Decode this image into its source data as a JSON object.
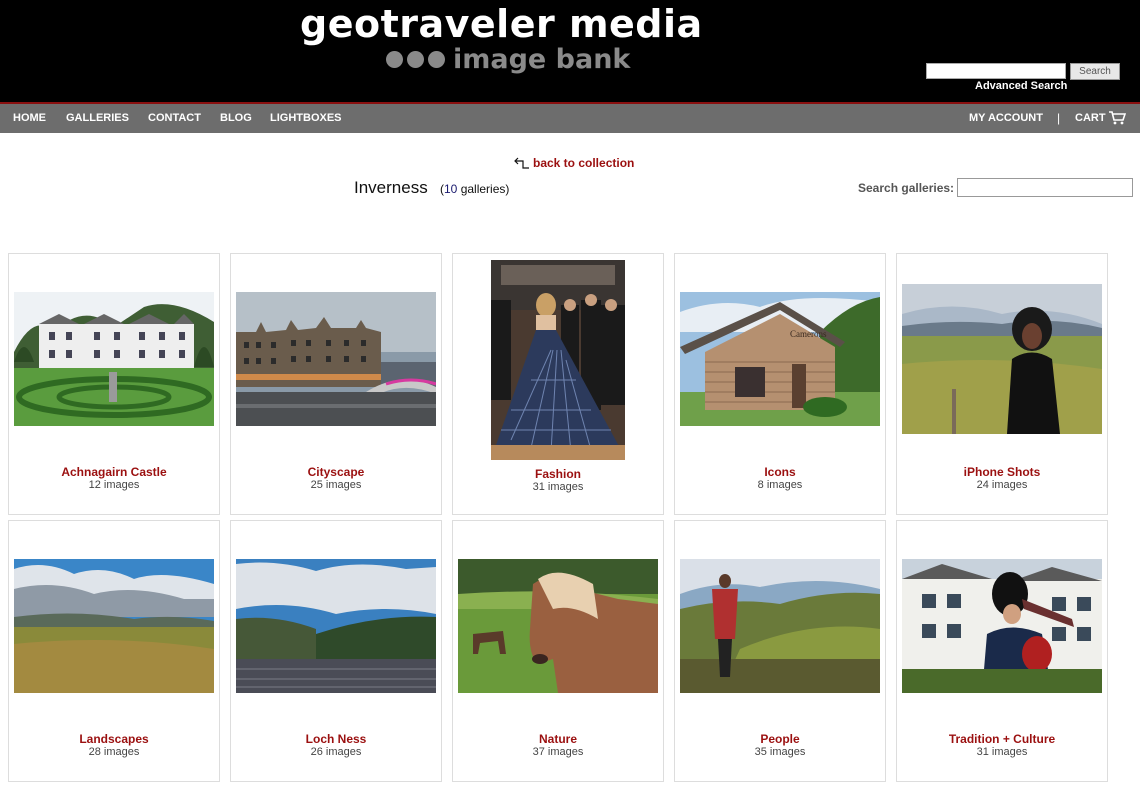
{
  "brand": {
    "title": "geotraveler media",
    "subtitle": "image bank"
  },
  "header_search": {
    "button_label": "Search",
    "advanced_label": "Advanced Search"
  },
  "nav": {
    "items": [
      "HOME",
      "GALLERIES",
      "CONTACT",
      "BLOG",
      "LIGHTBOXES"
    ],
    "account": "MY ACCOUNT",
    "separator": "|",
    "cart": "CART"
  },
  "page": {
    "back_link": "back to collection",
    "title": "Inverness",
    "count_open": "(",
    "count_number": "10",
    "count_rest": "galleries)",
    "search_label": "Search galleries:"
  },
  "galleries": [
    {
      "name": "Achnagairn Castle",
      "count": "12 images",
      "icon": "castle-photo"
    },
    {
      "name": "Cityscape",
      "count": "25 images",
      "icon": "city-photo"
    },
    {
      "name": "Fashion",
      "count": "31 images",
      "icon": "fashion-photo"
    },
    {
      "name": "Icons",
      "count": "8 images",
      "icon": "cabin-photo"
    },
    {
      "name": "iPhone Shots",
      "count": "24 images",
      "icon": "portrait-photo"
    },
    {
      "name": "Landscapes",
      "count": "28 images",
      "icon": "moor-photo"
    },
    {
      "name": "Loch Ness",
      "count": "26 images",
      "icon": "loch-photo"
    },
    {
      "name": "Nature",
      "count": "37 images",
      "icon": "pony-photo"
    },
    {
      "name": "People",
      "count": "35 images",
      "icon": "highlands-woman-photo"
    },
    {
      "name": "Tradition + Culture",
      "count": "31 images",
      "icon": "piper-photo"
    }
  ],
  "colors": {
    "header_bg": "#000000",
    "nav_bg": "#6d6d6d",
    "accent": "#9b1010",
    "link": "#9b1010"
  }
}
